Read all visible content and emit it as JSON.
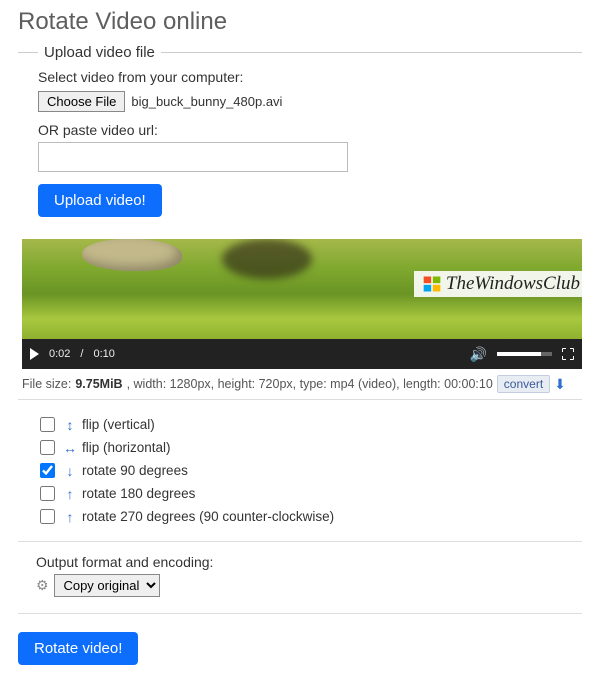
{
  "title": "Rotate Video online",
  "upload": {
    "legend": "Upload video file",
    "select_label": "Select video from your computer:",
    "choose_btn": "Choose File",
    "filename": "big_buck_bunny_480p.avi",
    "or_label": "OR paste video url:",
    "url_value": "",
    "upload_btn": "Upload video!"
  },
  "watermark": "TheWindowsClub",
  "player": {
    "current": "0:02",
    "sep": "/",
    "total": "0:10"
  },
  "fileinfo": {
    "prefix": "File size: ",
    "size": "9.75MiB",
    "rest": ", width: 1280px, height: 720px, type: mp4 (video), length: 00:00:10",
    "convert": "convert"
  },
  "options": [
    {
      "checked": false,
      "icon": "↕",
      "label": "flip (vertical)"
    },
    {
      "checked": false,
      "icon": "↔",
      "label": "flip (horizontal)"
    },
    {
      "checked": true,
      "icon": "↓",
      "label": "rotate 90 degrees"
    },
    {
      "checked": false,
      "icon": "↑",
      "label": "rotate 180 degrees"
    },
    {
      "checked": false,
      "icon": "↑",
      "label": "rotate 270 degrees (90 counter-clockwise)"
    }
  ],
  "output": {
    "label": "Output format and encoding:",
    "selected": "Copy original"
  },
  "rotate_btn": "Rotate video!"
}
